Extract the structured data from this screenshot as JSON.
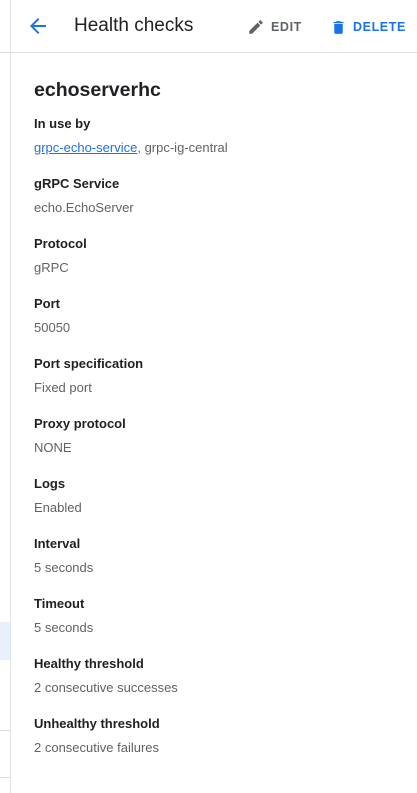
{
  "header": {
    "title": "Health checks",
    "edit_label": "EDIT",
    "delete_label": "DELETE"
  },
  "resource": {
    "name": "echoserverhc"
  },
  "fields": {
    "in_use_by": {
      "label": "In use by",
      "link_text": "grpc-echo-service",
      "separator": ", ",
      "other_text": "grpc-ig-central"
    },
    "grpc_service": {
      "label": "gRPC Service",
      "value": "echo.EchoServer"
    },
    "protocol": {
      "label": "Protocol",
      "value": "gRPC"
    },
    "port": {
      "label": "Port",
      "value": "50050"
    },
    "port_spec": {
      "label": "Port specification",
      "value": "Fixed port"
    },
    "proxy_protocol": {
      "label": "Proxy protocol",
      "value": "NONE"
    },
    "logs": {
      "label": "Logs",
      "value": "Enabled"
    },
    "interval": {
      "label": "Interval",
      "value": "5 seconds"
    },
    "timeout": {
      "label": "Timeout",
      "value": "5 seconds"
    },
    "healthy_threshold": {
      "label": "Healthy threshold",
      "value": "2 consecutive successes"
    },
    "unhealthy_threshold": {
      "label": "Unhealthy threshold",
      "value": "2 consecutive failures"
    }
  },
  "icons": {
    "back": "arrow-back-icon",
    "edit": "pencil-icon",
    "delete": "trash-icon"
  },
  "colors": {
    "accent": "#1a73e8",
    "muted": "#5f6368",
    "text": "#202124"
  }
}
